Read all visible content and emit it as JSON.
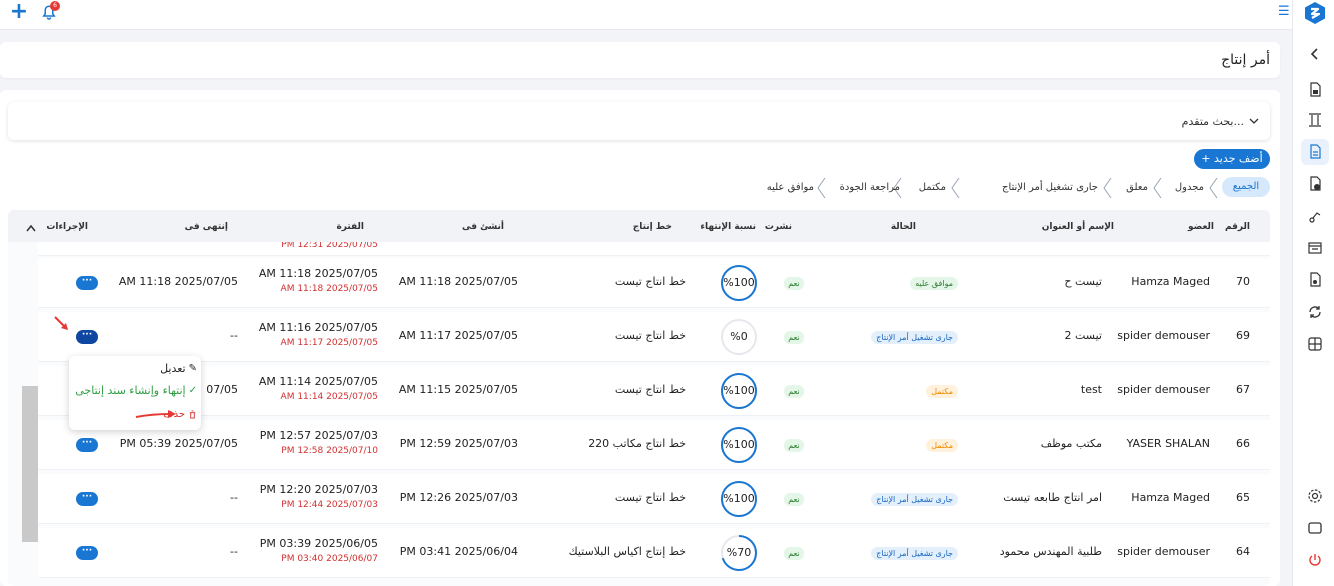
{
  "topbar": {
    "plus_icon": "plus-icon",
    "notifications_icon": "bell-icon",
    "notifications_count": "6",
    "menu_icon": "hamburger-icon"
  },
  "colors": {
    "accent": "#1976d2",
    "danger": "#e53935",
    "success": "#2e7d32",
    "warning": "#ef8a00"
  },
  "page": {
    "title": "أمر إنتاج"
  },
  "search": {
    "label": "بحث متقدم..."
  },
  "toolbar": {
    "add_label": "+ أضف جديد"
  },
  "filters": {
    "all": "الجميع",
    "items": [
      "مجدول",
      "معلق",
      "جارى تشغيل أمر الإنتاج",
      "مكتمل",
      "مراجعة الجودة",
      "موافق عليه"
    ]
  },
  "table": {
    "headers": {
      "number": "الرقم",
      "member": "العضو",
      "name": "الإسم أو العنوان",
      "status": "الحالة",
      "published": "نشرت",
      "completion": "نسبة الإنتهاء",
      "line": "خط إنتاج",
      "created": "أنشئ فى",
      "period": "الفترة",
      "ended": "إنتهى فى",
      "actions": "الإجراءات"
    },
    "partial_row": {
      "period_end": "PM 12:31 2025/07/05"
    },
    "rows": [
      {
        "number": "70",
        "member": "Hamza Maged",
        "name": "تيست ح",
        "status": "موافق عليه",
        "published": "نعم",
        "completion": "%100",
        "line": "خط انتاج تيست",
        "created": "AM 11:18 2025/07/05",
        "period_start": "AM 11:18 2025/07/05",
        "period_end": "AM 11:18 2025/07/05",
        "ended": "AM 11:18 2025/07/05",
        "actions": "···"
      },
      {
        "number": "69",
        "member": "spider demouser",
        "name": "تيست 2",
        "status": "جارى تشغيل أمر الإنتاج",
        "published": "نعم",
        "completion": "%0",
        "line": "خط انتاج تيست",
        "created": "AM 11:17 2025/07/05",
        "period_start": "AM 11:16 2025/07/05",
        "period_end": "AM 11:17 2025/07/05",
        "ended": "--",
        "actions": "···"
      },
      {
        "number": "67",
        "member": "spider demouser",
        "name": "test",
        "status": "مكتمل",
        "published": "نعم",
        "completion": "%100",
        "line": "خط انتاج تيست",
        "created": "AM 11:15 2025/07/05",
        "period_start": "AM 11:14 2025/07/05",
        "period_end": "AM 11:14 2025/07/05",
        "ended": "07/05",
        "actions": "···"
      },
      {
        "number": "66",
        "member": "YASER SHALAN",
        "name": "مكتب موظف",
        "status": "مكتمل",
        "published": "نعم",
        "completion": "%100",
        "line": "خط انتاج مكاتب 220",
        "created": "PM 12:59 2025/07/03",
        "period_start": "PM 12:57 2025/07/03",
        "period_end": "PM 12:58 2025/07/10",
        "ended": "PM 05:39 2025/07/05",
        "actions": "···"
      },
      {
        "number": "65",
        "member": "Hamza Maged",
        "name": "امر انتاج طابعه تيست",
        "status": "جارى تشغيل أمر الإنتاج",
        "published": "نعم",
        "completion": "%100",
        "line": "خط انتاج تيست",
        "created": "PM 12:26 2025/07/03",
        "period_start": "PM 12:20 2025/07/03",
        "period_end": "PM 12:44 2025/07/03",
        "ended": "--",
        "actions": "···"
      },
      {
        "number": "64",
        "member": "spider demouser",
        "name": "طلبية المهندس محمود",
        "status": "جارى تشغيل أمر الإنتاج",
        "published": "نعم",
        "completion": "%70",
        "line": "خط إنتاج اكياس البلاستيك",
        "created": "PM 03:41 2025/06/04",
        "period_start": "PM 03:39 2025/06/05",
        "period_end": "PM 03:40 2025/06/07",
        "ended": "--",
        "actions": "···"
      }
    ],
    "completion_values": [
      100,
      0,
      100,
      100,
      100,
      70
    ]
  },
  "context_menu": {
    "edit": "تعديل",
    "finish": "إنتهاء وإنشاء سند إنتاجى",
    "delete": "حذف"
  }
}
